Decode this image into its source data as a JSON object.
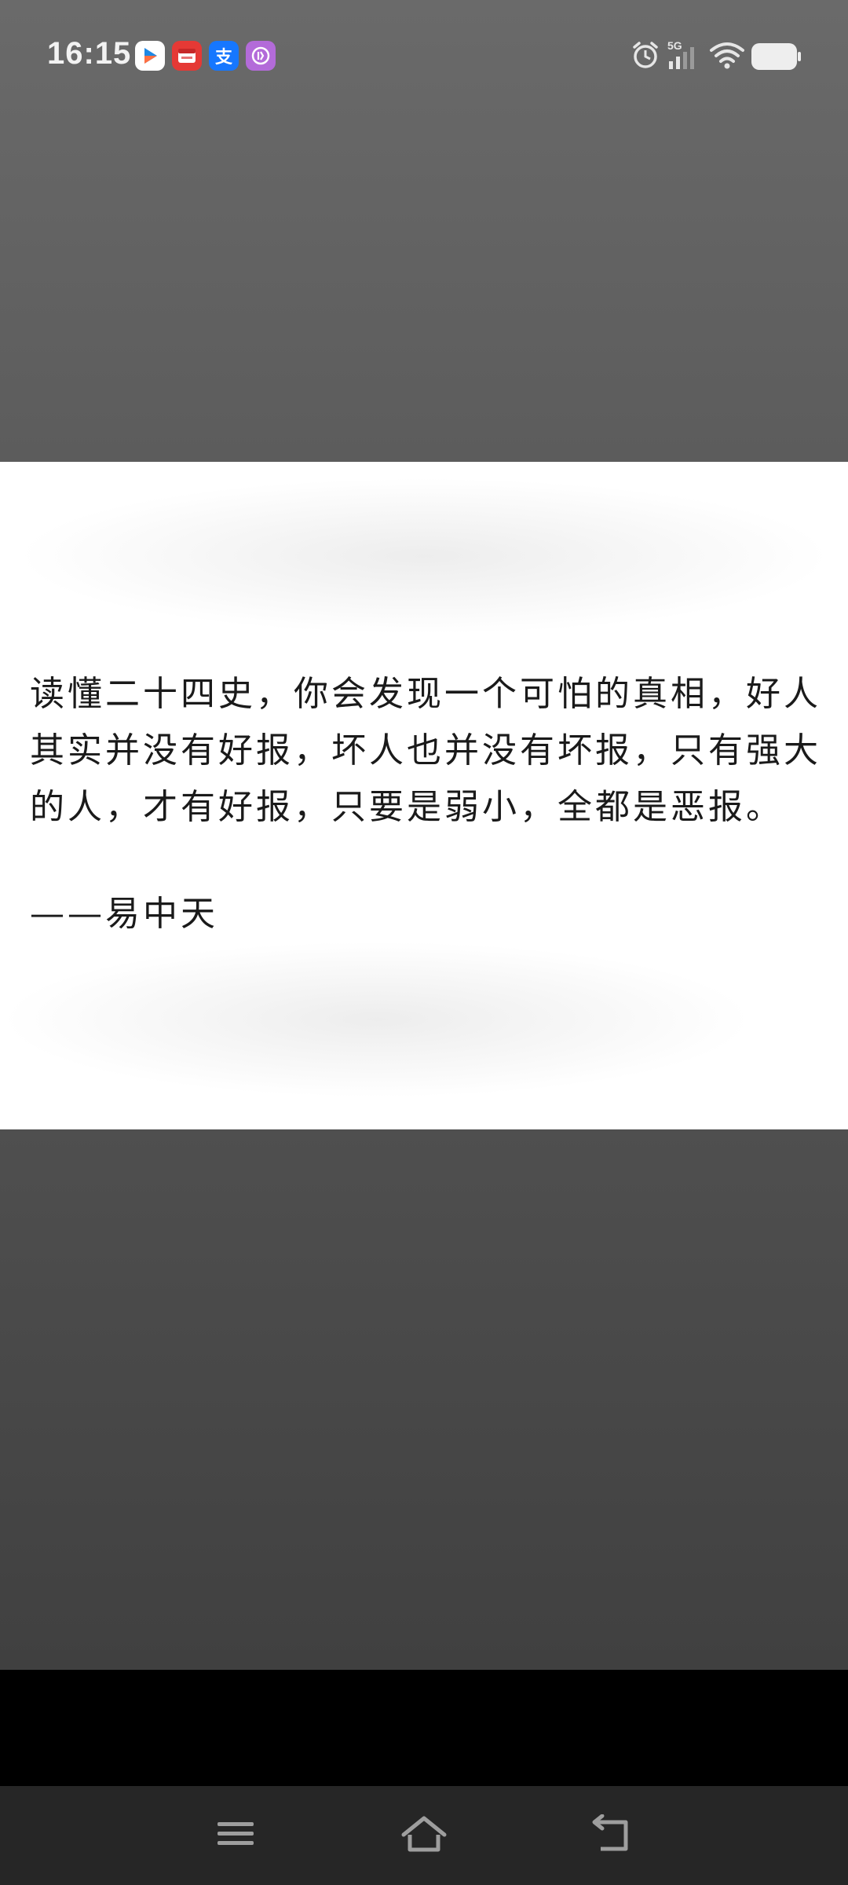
{
  "status_bar": {
    "time": "16:15",
    "notification_icons": [
      "video-app-icon",
      "calendar-app-icon",
      "alipay-icon",
      "wallet-app-icon"
    ],
    "alipay_glyph": "支",
    "system_icons": [
      "alarm-icon",
      "5g-signal-icon",
      "wifi-icon",
      "battery-icon"
    ],
    "network_label": "5G"
  },
  "content": {
    "quote": "读懂二十四史，你会发现一个可怕的真相，好人其实并没有好报，坏人也并没有坏报，只有强大的人，才有好报，只要是弱小，全都是恶报。",
    "author": "——易中天"
  },
  "nav_bar": {
    "buttons": [
      "menu-icon",
      "home-icon",
      "back-icon"
    ]
  },
  "colors": {
    "dim_overlay_top": "#636363",
    "dim_overlay_bottom": "#454545",
    "card_background": "#ffffff",
    "text": "#1a1a1a",
    "nav_background": "#262626"
  }
}
